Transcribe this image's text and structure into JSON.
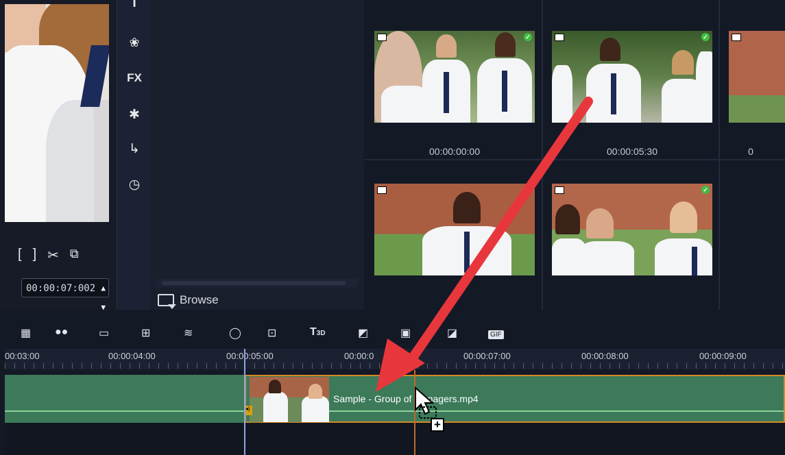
{
  "preview": {
    "timecode": "00:00:07:002",
    "transport": {
      "mark_in": "[",
      "mark_out": "]"
    }
  },
  "library": {
    "browse_label": "Browse",
    "thumbnails": [
      {
        "time": "00:00:00:00",
        "checked": true
      },
      {
        "time": "00:00:05:30",
        "checked": true
      },
      {
        "time": "0",
        "checked": false
      },
      {
        "time": "",
        "checked": false
      },
      {
        "time": "",
        "checked": true
      }
    ]
  },
  "tools": {
    "fx_label": "FX",
    "t3d_label": "T",
    "t3d_sub": "3D",
    "gif_label": "GIF"
  },
  "timeline": {
    "ruler_labels": [
      "00:03:00",
      "00:00:04:00",
      "00:00:05:00",
      "00:00:0",
      "00:00:07:00",
      "00:00:08:00",
      "00:00:09:00"
    ],
    "clip_title": "Sample - Group of teenagers.mp4"
  },
  "colors": {
    "annotation_arrow": "#e8373c",
    "track": "#3c7a5a",
    "selection": "#d48a25",
    "playhead": "#8fa4e8"
  },
  "icons": [
    "title-icon",
    "graphics-icon",
    "fx-icon",
    "transition-icon",
    "path-icon",
    "speed-icon",
    "scissors-icon",
    "snapshot-icon"
  ]
}
